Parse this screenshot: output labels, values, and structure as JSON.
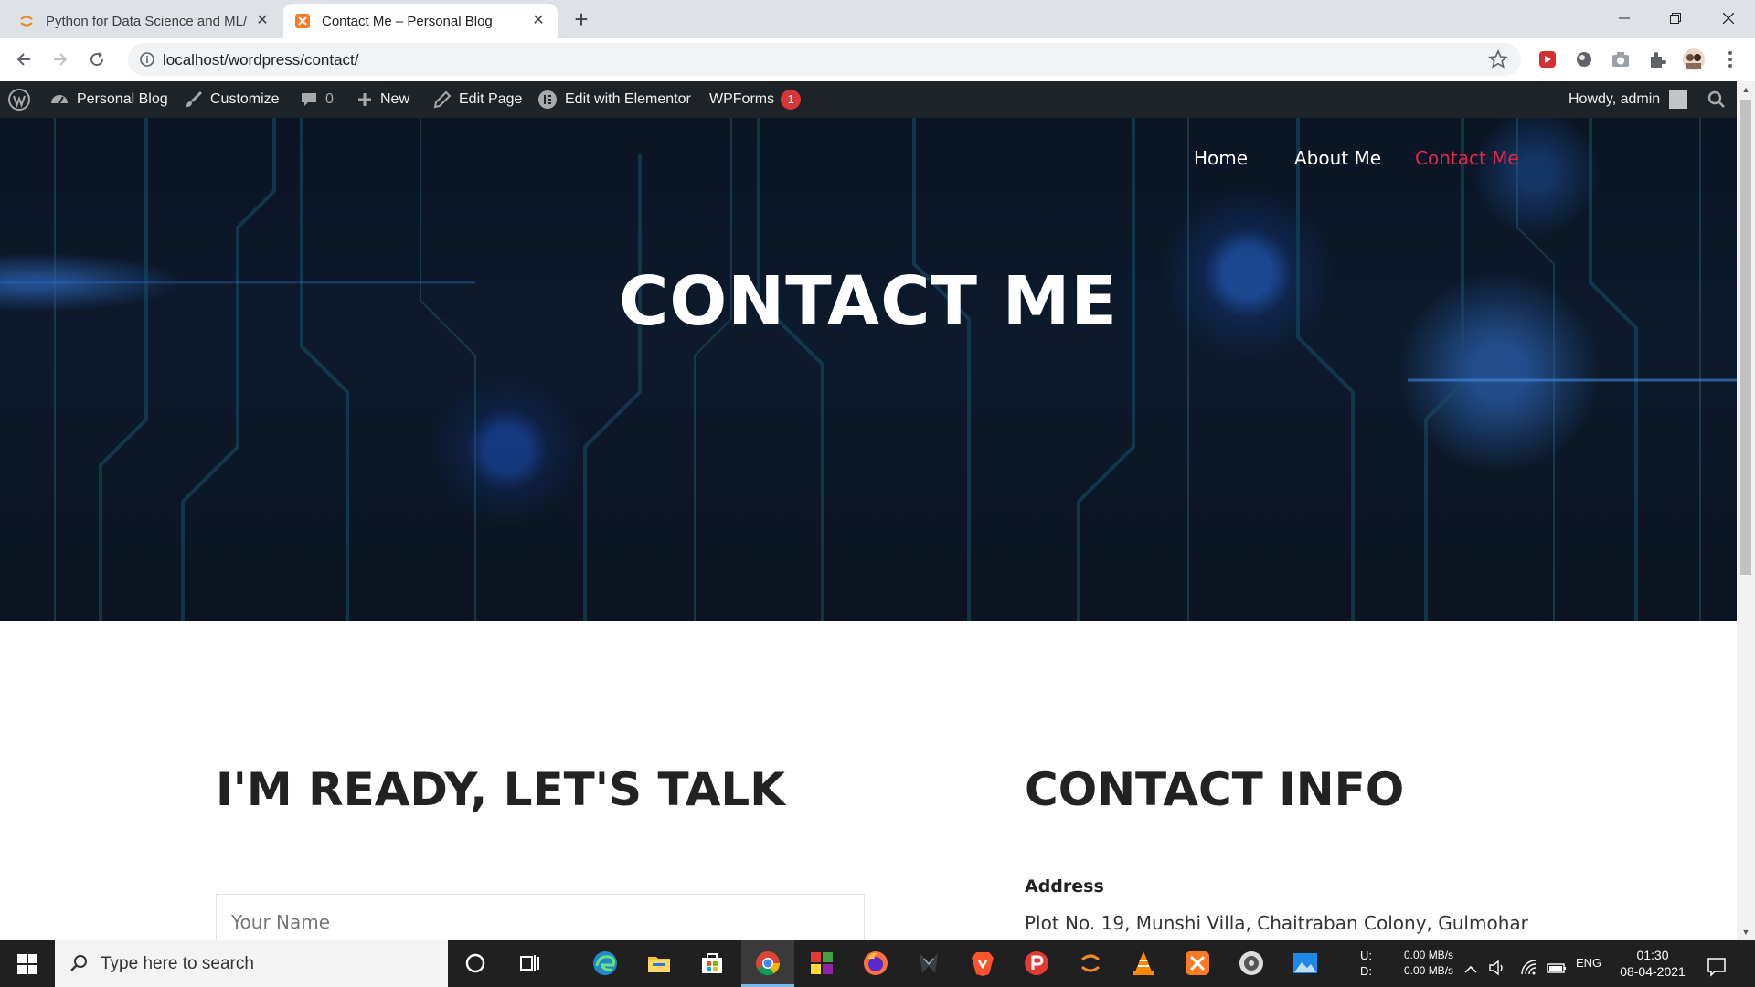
{
  "browser": {
    "tabs": [
      {
        "title": "Python for Data Science and ML/",
        "active": false
      },
      {
        "title": "Contact Me – Personal Blog",
        "active": true
      }
    ],
    "url": "localhost/wordpress/contact/"
  },
  "adminbar": {
    "site_name": "Personal Blog",
    "customize": "Customize",
    "comments_count": "0",
    "new": "New",
    "edit_page": "Edit Page",
    "elementor": "Edit with Elementor",
    "wpforms": "WPForms",
    "wpforms_badge": "1",
    "howdy": "Howdy, admin"
  },
  "hero": {
    "nav": [
      "Home",
      "About Me",
      "Contact Me"
    ],
    "active_nav_color": "#e2264d",
    "title": "CONTACT ME"
  },
  "content": {
    "left_heading": "I'M READY, LET'S TALK",
    "name_placeholder": "Your Name",
    "right_heading": "CONTACT INFO",
    "address_label": "Address",
    "address_line": "Plot No. 19, Munshi Villa, Chaitraban Colony, Gulmohar"
  },
  "taskbar": {
    "search_placeholder": "Type here to search",
    "net_upload_label": "U:",
    "net_download_label": "D:",
    "net_upload": "0.00 MB/s",
    "net_download": "0.00 MB/s",
    "language": "ENG",
    "time": "01:30",
    "date": "08-04-2021"
  }
}
